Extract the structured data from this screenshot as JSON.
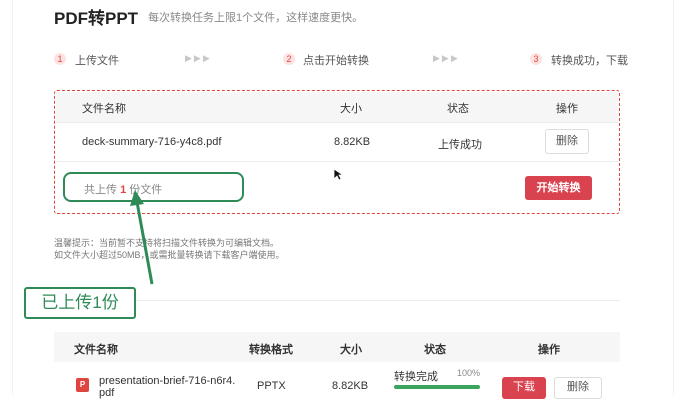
{
  "header": {
    "title": "PDF转PPT",
    "subtitle": "每次转换任务上限1个文件，这样速度更快。"
  },
  "steps": [
    {
      "num": "1",
      "label": "上传文件"
    },
    {
      "num": "2",
      "label": "点击开始转换"
    },
    {
      "num": "3",
      "label": "转换成功，下载"
    }
  ],
  "step_separator": "▶▶▶",
  "upload_table": {
    "columns": [
      "文件名称",
      "大小",
      "状态",
      "操作"
    ],
    "row": {
      "name": "deck-summary-716-y4c8.pdf",
      "size": "8.82KB",
      "status": "上传成功",
      "action": "删除"
    },
    "count_prefix": "共上传",
    "count_value": "1",
    "count_suffix": "份文件",
    "start_button": "开始转换"
  },
  "tips": {
    "line1": "温馨提示：当前暂不支持将扫描文件转换为可编辑文档。",
    "line2": "如文件大小超过50MB，或需批量转换请下载客户端使用。"
  },
  "annotation": {
    "label": "已上传1份",
    "color": "#2e8b57"
  },
  "result_table": {
    "columns": [
      "文件名称",
      "转换格式",
      "大小",
      "状态",
      "操作"
    ],
    "row": {
      "name_line1": "presentation-brief-716-n6r4.",
      "name_line2": "pdf",
      "format": "PPTX",
      "size": "8.82KB",
      "status": "转换完成",
      "progress_label": "100%",
      "progress": 1.0,
      "download": "下载",
      "delete": "删除"
    }
  },
  "colors": {
    "accent": "#e0443f",
    "button_red": "#d9434f",
    "annotation_green": "#2e8b57",
    "progress_green": "#3aa55d"
  },
  "icons": {
    "file": "pdf-file-icon",
    "cursor": "mouse-cursor-icon",
    "arrow": "annotation-arrow-icon"
  }
}
